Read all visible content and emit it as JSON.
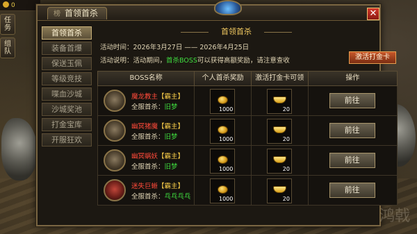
{
  "hud": {
    "gold": "0"
  },
  "side_tabs": [
    "任务",
    "组队"
  ],
  "window": {
    "header_tab_prefix": "榜",
    "title": "首领首杀",
    "close_glyph": "✕"
  },
  "nav": {
    "items": [
      {
        "label": "首领首杀",
        "active": true
      },
      {
        "label": "装备首爆"
      },
      {
        "label": "保送玉佩"
      },
      {
        "label": "等级竞技"
      },
      {
        "label": "喋血沙城"
      },
      {
        "label": "沙城奖池"
      },
      {
        "label": "打金宝库"
      },
      {
        "label": "开服狂欢"
      }
    ]
  },
  "content": {
    "banner": "首领首杀",
    "time_label": "活动时间：",
    "time_value": "2026年3月27日 —— 2026年4月25日",
    "desc_label": "活动说明：活动期间，",
    "desc_highlight": "首杀BOSS",
    "desc_rest": "可以获得高额奖励，请注意查收",
    "activate_button": "激活打金卡"
  },
  "table": {
    "headers": [
      "BOSS名称",
      "个人首杀奖励",
      "激活打金卡可领",
      "操作"
    ],
    "rows": [
      {
        "boss": "魔龙教主",
        "tag": "【霸主】",
        "first_label": "全服首杀：",
        "first_who": "旧梦",
        "coin_qty": "1000",
        "ingot_qty": "20",
        "button": "前往"
      },
      {
        "boss": "幽冥猪魔",
        "tag": "【霸主】",
        "first_label": "全服首杀：",
        "first_who": "旧梦",
        "coin_qty": "1000",
        "ingot_qty": "20",
        "button": "前往"
      },
      {
        "boss": "幽冥蜗妖",
        "tag": "【霸主】",
        "first_label": "全服首杀：",
        "first_who": "旧梦",
        "coin_qty": "1000",
        "ingot_qty": "20",
        "button": "前往"
      },
      {
        "boss": "迷失巨蜥",
        "tag": "【霸主】",
        "first_label": "全服首杀：",
        "first_who": "乓乓乓乓",
        "coin_qty": "1000",
        "ingot_qty": "20",
        "button": "前往"
      }
    ]
  },
  "watermark": "鸿戟",
  "colors": {
    "frame": "#7a6642",
    "highlight_green": "#3fdc3f",
    "boss_red": "#ff4a3a",
    "tag_gold": "#ffd24a",
    "activate_orange": "#c8582a"
  }
}
